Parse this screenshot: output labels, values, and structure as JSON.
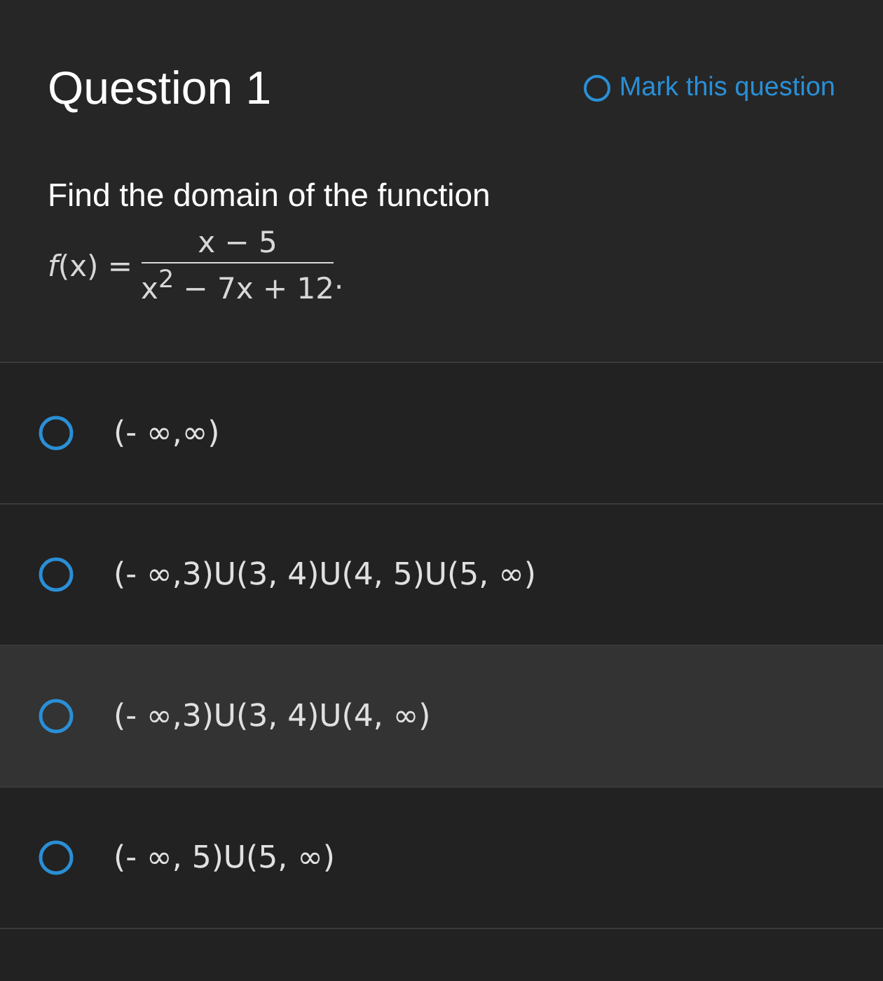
{
  "question": {
    "title": "Question 1",
    "mark": {
      "label": "Mark this question",
      "checked": false
    },
    "prompt": "Find the domain of the function",
    "formula": {
      "lhs": "*f*(x) =",
      "numerator": "x − 5",
      "denominator": "x$^{2}$ − 7x + 12",
      "end": "."
    }
  },
  "options": [
    {
      "label": "(- ∞,∞)",
      "selected": false,
      "hovered": false
    },
    {
      "label": "(- ∞,3)U(3, 4)U(4, 5)U(5, ∞)",
      "selected": false,
      "hovered": false
    },
    {
      "label": "(- ∞,3)U(3, 4)U(4, ∞)",
      "selected": false,
      "hovered": true
    },
    {
      "label": "(- ∞, 5)U(5, ∞)",
      "selected": false,
      "hovered": false
    }
  ]
}
